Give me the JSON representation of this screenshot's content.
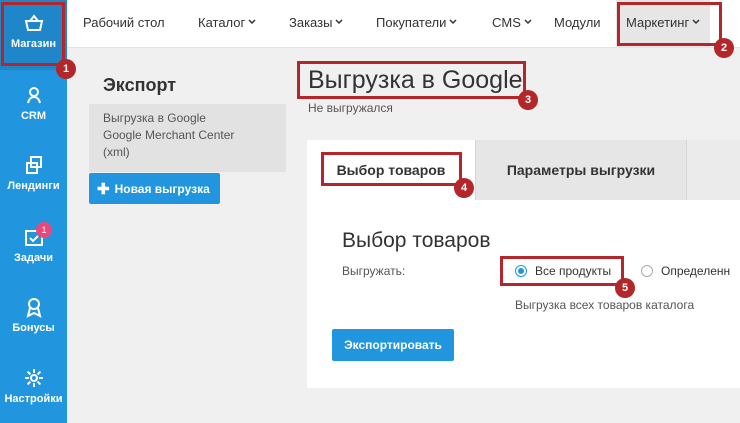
{
  "colors": {
    "accent": "#2196de",
    "annotation": "#b3262a",
    "badge": "#e8497a"
  },
  "sidebar": {
    "items": [
      {
        "label": "Магазин",
        "icon": "shopping-basket-icon"
      },
      {
        "label": "CRM",
        "icon": "user-icon"
      },
      {
        "label": "Лендинги",
        "icon": "landing-icon"
      },
      {
        "label": "Задачи",
        "icon": "tasks-icon",
        "badge": "1"
      },
      {
        "label": "Бонусы",
        "icon": "award-icon"
      },
      {
        "label": "Настройки",
        "icon": "gear-icon"
      }
    ]
  },
  "topnav": {
    "items": [
      {
        "label": "Рабочий стол"
      },
      {
        "label": "Каталог",
        "has_dropdown": true
      },
      {
        "label": "Заказы",
        "has_dropdown": true
      },
      {
        "label": "Покупатели",
        "has_dropdown": true
      },
      {
        "label": "CMS",
        "has_dropdown": true
      },
      {
        "label": "Модули"
      },
      {
        "label": "Маркетинг",
        "has_dropdown": true
      }
    ]
  },
  "left_panel": {
    "title": "Экспорт",
    "export_item": {
      "line1": "Выгрузка в Google",
      "line2": "Google Merchant Center",
      "line3": "(xml)"
    },
    "new_export_label": "Новая выгрузка"
  },
  "main": {
    "title": "Выгрузка в Google",
    "status": "Не выгружался",
    "tabs": [
      {
        "label": "Выбор товаров"
      },
      {
        "label": "Параметры выгрузки"
      }
    ],
    "section_title": "Выбор товаров",
    "export_label": "Выгружать:",
    "options": [
      {
        "label": "Все продукты",
        "selected": true
      },
      {
        "label": "Определенн",
        "selected": false
      }
    ],
    "hint": "Выгрузка всех товаров каталога",
    "export_button": "Экспортировать"
  },
  "annotations": [
    "1",
    "2",
    "3",
    "4",
    "5"
  ]
}
